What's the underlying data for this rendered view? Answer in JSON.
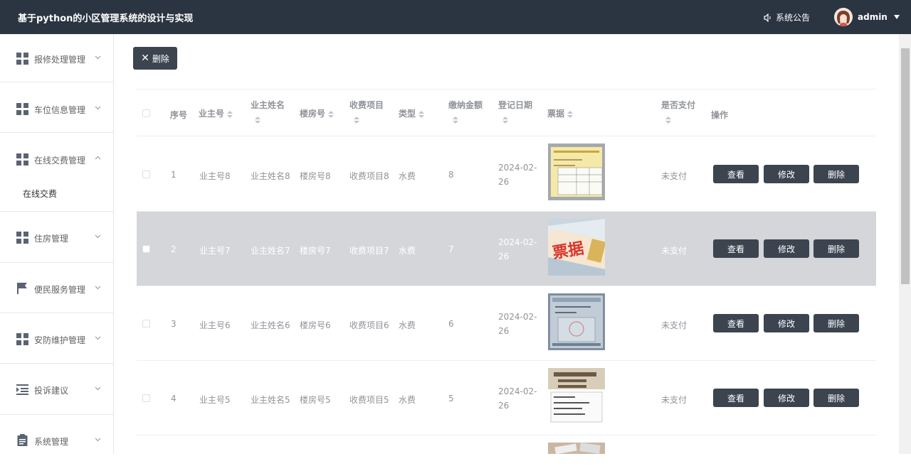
{
  "header": {
    "title": "基于python的小区管理系统的设计与实现",
    "notice": "系统公告",
    "user": "admin"
  },
  "sidebar": {
    "items": [
      {
        "label": "报修处理管理",
        "icon": "grid-icon",
        "expanded": false
      },
      {
        "label": "车位信息管理",
        "icon": "grid-icon",
        "expanded": false
      },
      {
        "label": "在线交费管理",
        "icon": "grid-icon",
        "expanded": true,
        "sub": "在线交费"
      },
      {
        "label": "住房管理",
        "icon": "grid-icon",
        "expanded": false
      },
      {
        "label": "便民服务管理",
        "icon": "flag-icon",
        "expanded": false
      },
      {
        "label": "安防维护管理",
        "icon": "grid-icon",
        "expanded": false
      },
      {
        "label": "投诉建议",
        "icon": "indent-icon",
        "expanded": false
      },
      {
        "label": "系统管理",
        "icon": "clipboard-icon",
        "expanded": false
      }
    ]
  },
  "toolbar": {
    "delete_label": "删除",
    "delete_icon": "close-icon"
  },
  "table": {
    "columns": {
      "index": "序号",
      "owner_no": "业主号",
      "owner_name": "业主姓名",
      "room_no": "楼房号",
      "fee_item": "收费项目",
      "type": "类型",
      "amount": "缴纳金额",
      "date": "登记日期",
      "receipt": "票据",
      "paid": "是否支付",
      "actions": "操作"
    },
    "actions": {
      "view": "查看",
      "edit": "修改",
      "delete": "删除"
    },
    "rows": [
      {
        "index": "1",
        "owner_no": "业主号8",
        "owner_name": "业主姓名8",
        "room_no": "楼房号8",
        "fee_item": "收费项目8",
        "type": "水费",
        "amount": "8",
        "date_a": "2024-02-",
        "date_b": "26",
        "paid": "未支付"
      },
      {
        "index": "2",
        "owner_no": "业主号7",
        "owner_name": "业主姓名7",
        "room_no": "楼房号7",
        "fee_item": "收费项目7",
        "type": "水费",
        "amount": "7",
        "date_a": "2024-02-",
        "date_b": "26",
        "paid": "未支付",
        "receipt_text": "票据"
      },
      {
        "index": "3",
        "owner_no": "业主号6",
        "owner_name": "业主姓名6",
        "room_no": "楼房号6",
        "fee_item": "收费项目6",
        "type": "水费",
        "amount": "6",
        "date_a": "2024-02-",
        "date_b": "26",
        "paid": "未支付"
      },
      {
        "index": "4",
        "owner_no": "业主号5",
        "owner_name": "业主姓名5",
        "room_no": "楼房号5",
        "fee_item": "收费项目5",
        "type": "水费",
        "amount": "5",
        "date_a": "2024-02-",
        "date_b": "26",
        "paid": "未支付"
      }
    ]
  }
}
